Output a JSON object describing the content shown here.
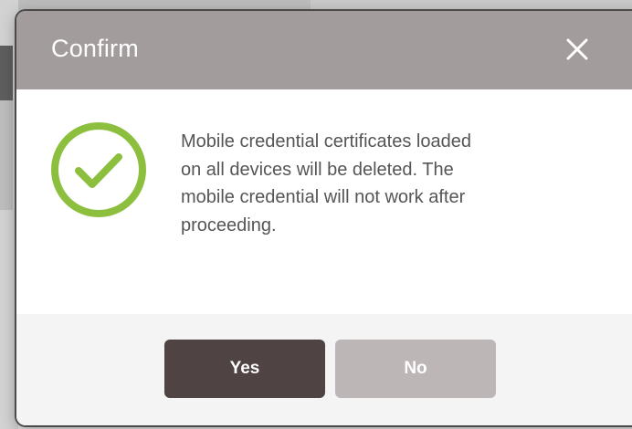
{
  "dialog": {
    "title": "Confirm",
    "close_icon": "close-icon",
    "status_icon": "check-circle-icon",
    "message": "Mobile credential certificates loaded\non all devices will be deleted. The\nmobile credential will not work after\nproceeding.",
    "buttons": {
      "yes_label": "Yes",
      "no_label": "No"
    }
  },
  "colors": {
    "header_bg": "#a29c9c",
    "check_green": "#8dbf3f",
    "yes_bg": "#4f4344",
    "no_bg": "#bcb6b6",
    "footer_bg": "#f4f4f4"
  }
}
